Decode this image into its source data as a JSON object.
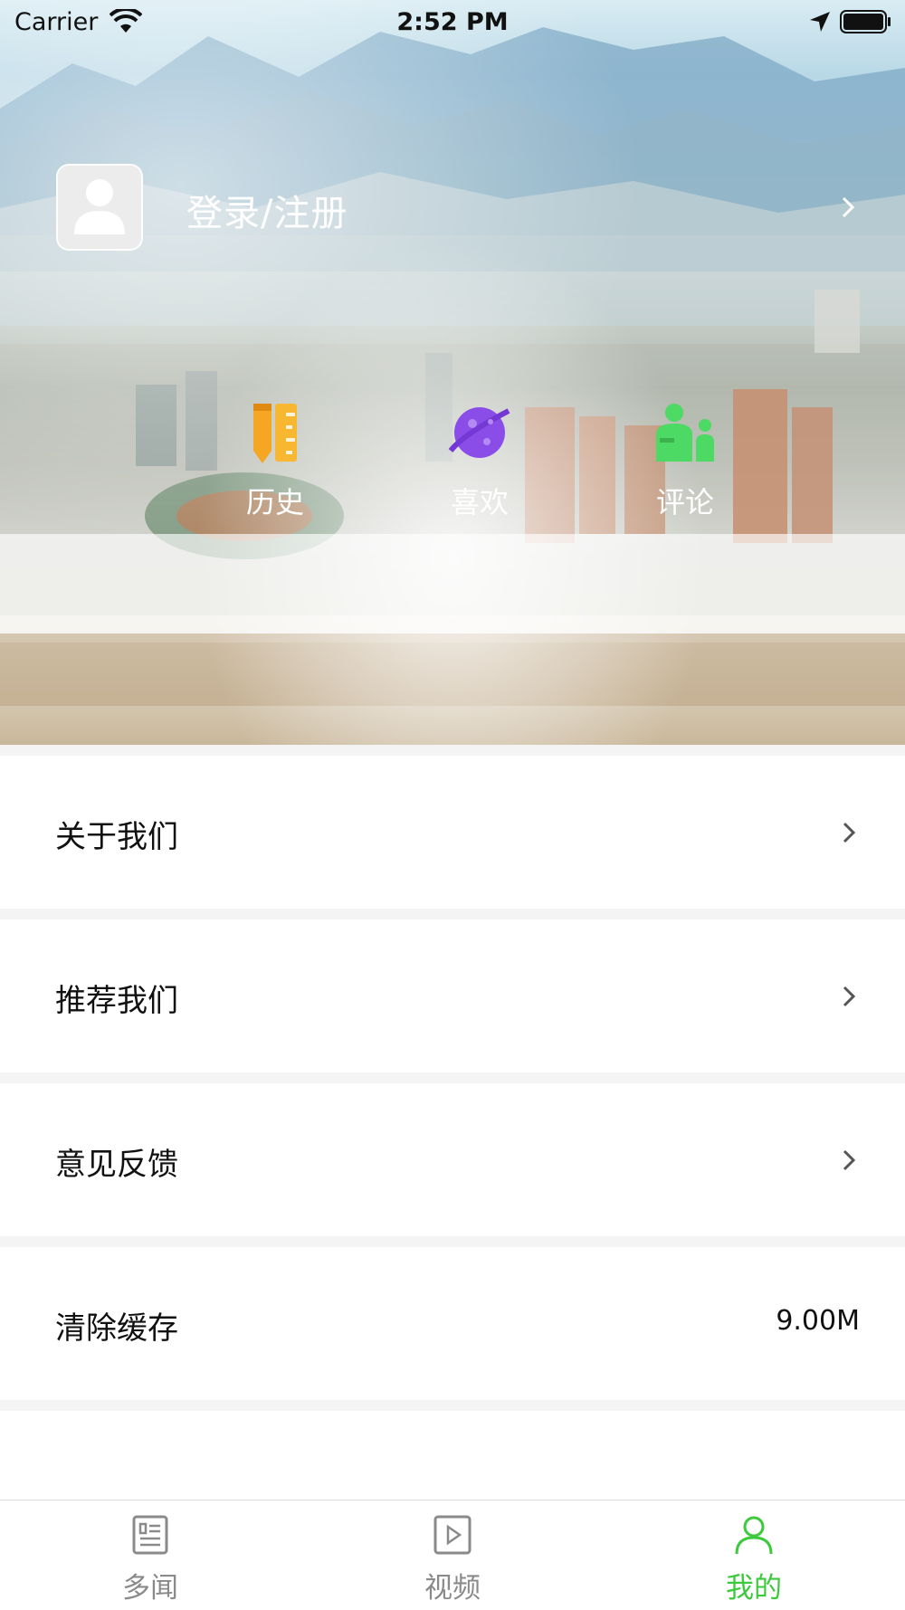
{
  "status_bar": {
    "carrier": "Carrier",
    "time": "2:52 PM"
  },
  "header": {
    "login_label": "登录/注册",
    "quick_actions": [
      {
        "label": "历史",
        "icon": "ruler-pencil-icon",
        "color": "#f5a623"
      },
      {
        "label": "喜欢",
        "icon": "planet-icon",
        "color": "#8a4de8"
      },
      {
        "label": "评论",
        "icon": "people-chat-icon",
        "color": "#4cd964"
      }
    ]
  },
  "menu": {
    "items": [
      {
        "label": "关于我们"
      },
      {
        "label": "推荐我们"
      },
      {
        "label": "意见反馈"
      }
    ],
    "cache": {
      "label": "清除缓存",
      "value": "9.00M"
    }
  },
  "tabbar": {
    "tabs": [
      {
        "label": "多闻",
        "icon": "news-icon"
      },
      {
        "label": "视频",
        "icon": "video-icon"
      },
      {
        "label": "我的",
        "icon": "person-icon"
      }
    ],
    "active_color": "#3cc93c",
    "inactive_color": "#8a8a8a"
  }
}
